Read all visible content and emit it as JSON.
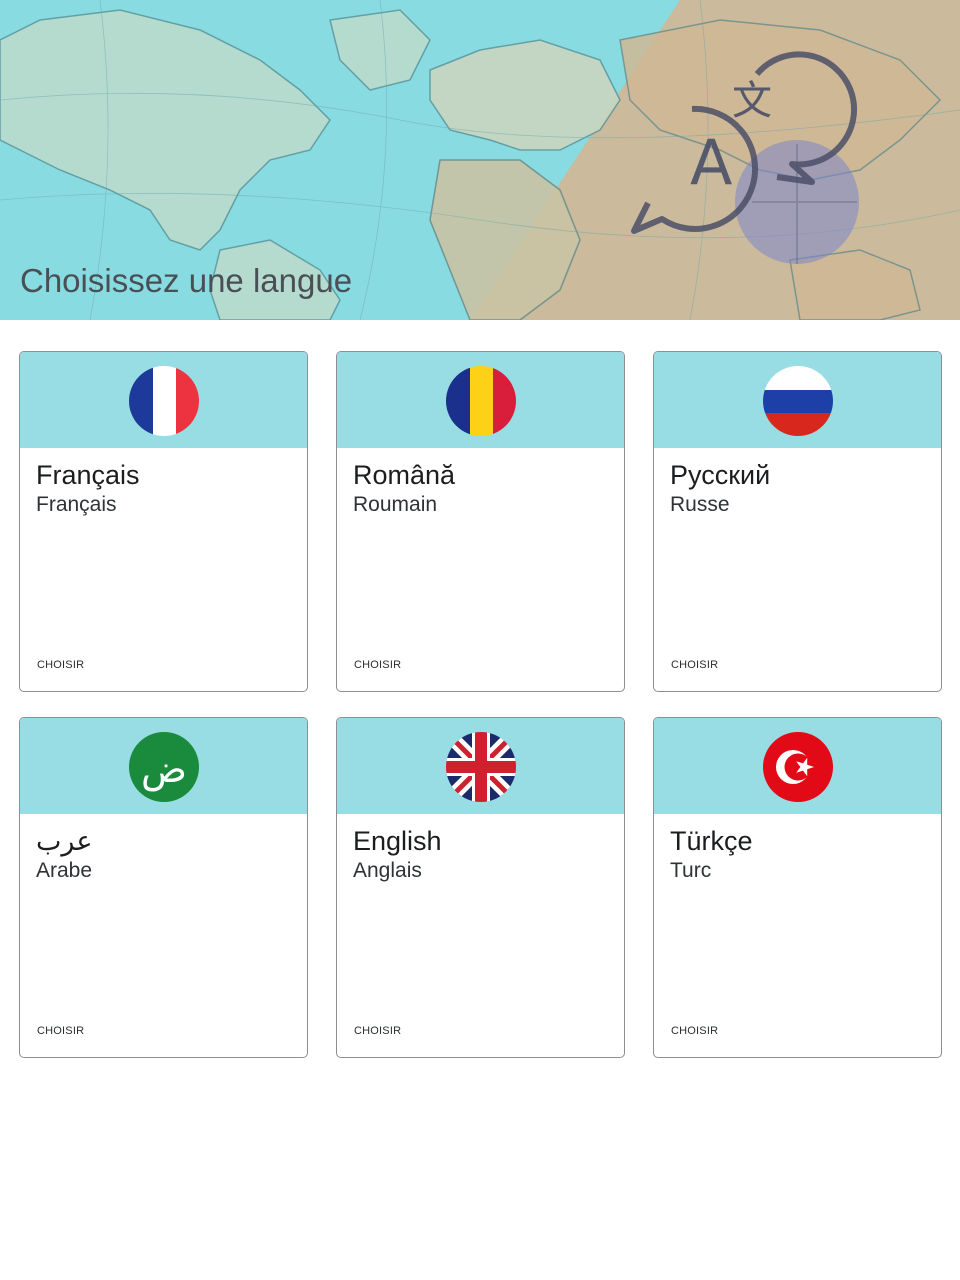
{
  "header": {
    "title": "Choisissez une langue",
    "background": "world-map-illustration",
    "icon": "translate-icon"
  },
  "colors": {
    "card_top": "#98dde4",
    "card_border": "#8a8f93",
    "hero_sea": "#8fdde0"
  },
  "languages": [
    {
      "native": "Français",
      "translated": "Français",
      "action": "CHOISIR",
      "flag": "france-flag-icon"
    },
    {
      "native": "Română",
      "translated": "Roumain",
      "action": "CHOISIR",
      "flag": "romania-flag-icon"
    },
    {
      "native": "Русский",
      "translated": "Russe",
      "action": "CHOISIR",
      "flag": "russia-flag-icon"
    },
    {
      "native": "عرب",
      "translated": "Arabe",
      "action": "CHOISIR",
      "flag": "arabic-letter-icon"
    },
    {
      "native": "English",
      "translated": "Anglais",
      "action": "CHOISIR",
      "flag": "uk-flag-icon"
    },
    {
      "native": "Türkçe",
      "translated": "Turc",
      "action": "CHOISIR",
      "flag": "turkey-flag-icon"
    }
  ]
}
